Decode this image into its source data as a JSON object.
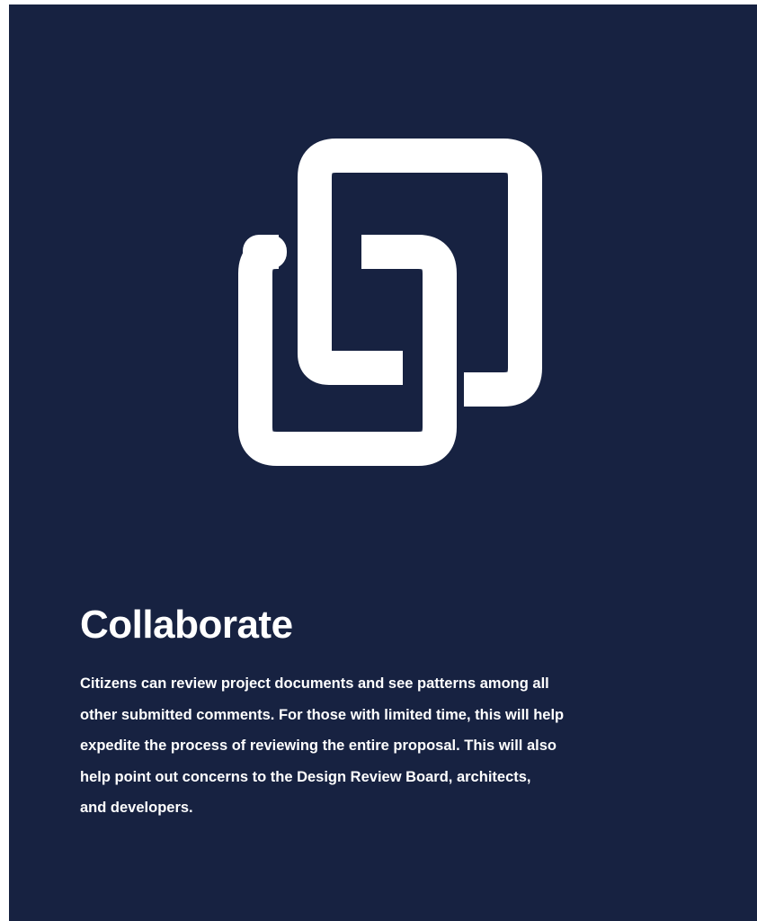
{
  "colors": {
    "background": "#172241",
    "foreground": "#ffffff"
  },
  "icon": "link-squares-icon",
  "title": "Collaborate",
  "description_lines": [
    "Citizens can review project documents and see patterns among all",
    "other submitted comments. For those with limited time, this will help",
    "expedite the process of reviewing the entire proposal. This will also",
    "help point out concerns to the Design Review Board, architects,",
    "and developers."
  ]
}
